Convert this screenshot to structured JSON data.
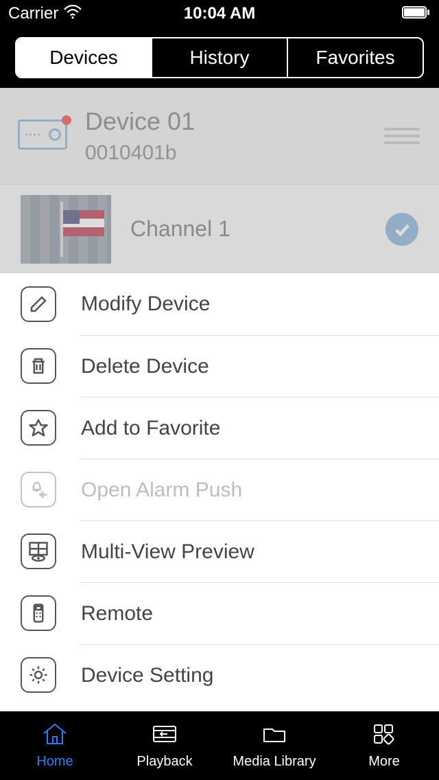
{
  "statusbar": {
    "carrier": "Carrier",
    "time": "10:04 AM"
  },
  "segmented": {
    "devices": "Devices",
    "history": "History",
    "favorites": "Favorites",
    "active": "devices"
  },
  "device": {
    "name": "Device 01",
    "id": "0010401b"
  },
  "channel": {
    "label": "Channel 1",
    "selected": true
  },
  "actions": {
    "modify": "Modify Device",
    "delete": "Delete Device",
    "favorite": "Add to Favorite",
    "alarm": "Open Alarm Push",
    "multiview": "Multi-View Preview",
    "remote": "Remote",
    "setting": "Device Setting"
  },
  "tabs": {
    "home": "Home",
    "playback": "Playback",
    "media": "Media Library",
    "more": "More",
    "active": "home"
  }
}
